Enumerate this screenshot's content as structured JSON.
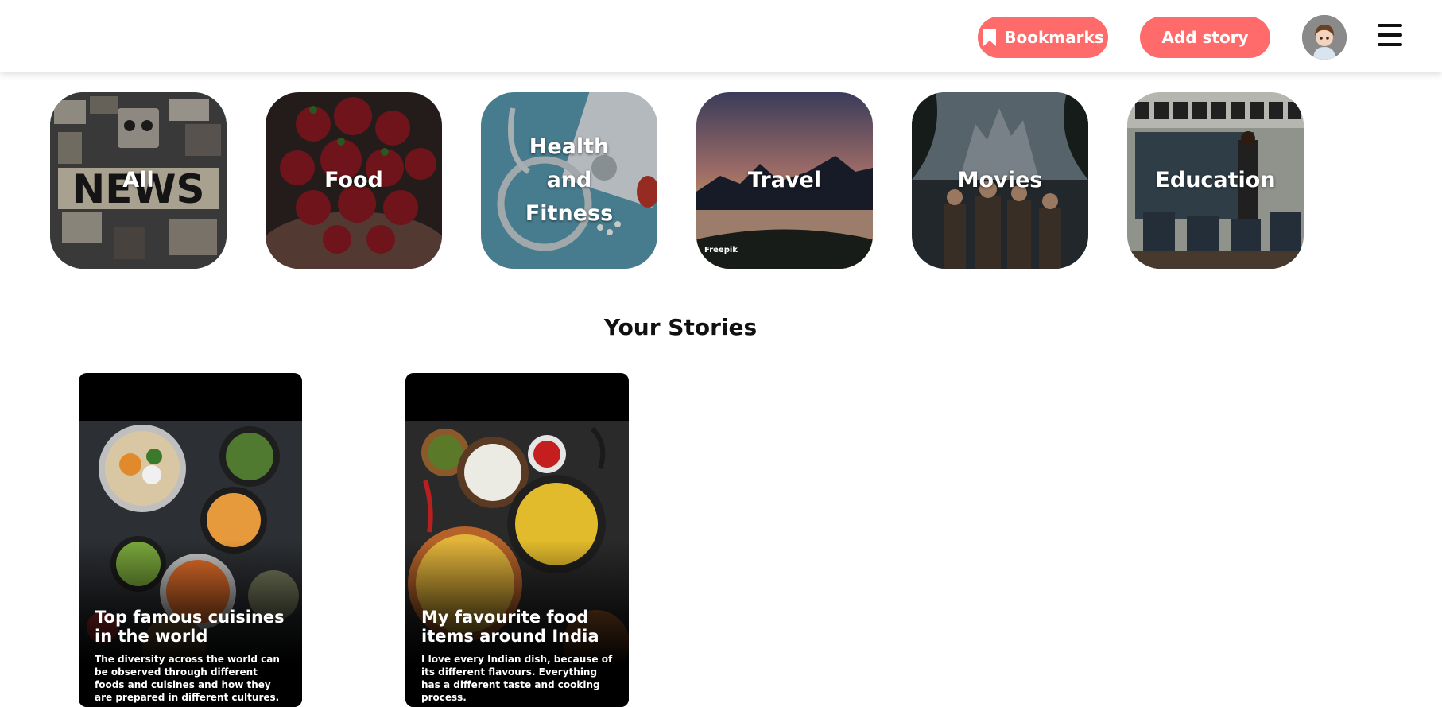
{
  "header": {
    "bookmarks_label": "Bookmarks",
    "add_story_label": "Add story",
    "accent_color": "#ff6b6b"
  },
  "categories": [
    {
      "label": "All",
      "selected": true
    },
    {
      "label": "Food",
      "selected": false
    },
    {
      "label": "Health and Fitness",
      "selected": false
    },
    {
      "label": "Travel",
      "selected": false
    },
    {
      "label": "Movies",
      "selected": false
    },
    {
      "label": "Education",
      "selected": false
    }
  ],
  "travel_watermark": "Freepik",
  "selected_color": "#149ac9",
  "section_title": "Your Stories",
  "stories": [
    {
      "title": "Top famous cuisines in the world",
      "description": "The diversity across the world can be observed through different foods and cuisines and how they are prepared in different cultures."
    },
    {
      "title": "My favourite food items around India",
      "description": "I love every Indian dish, because of its different flavours. Everything has a different taste and cooking process."
    }
  ],
  "icons": [
    "bookmark-icon",
    "avatar",
    "hamburger-menu-icon"
  ]
}
